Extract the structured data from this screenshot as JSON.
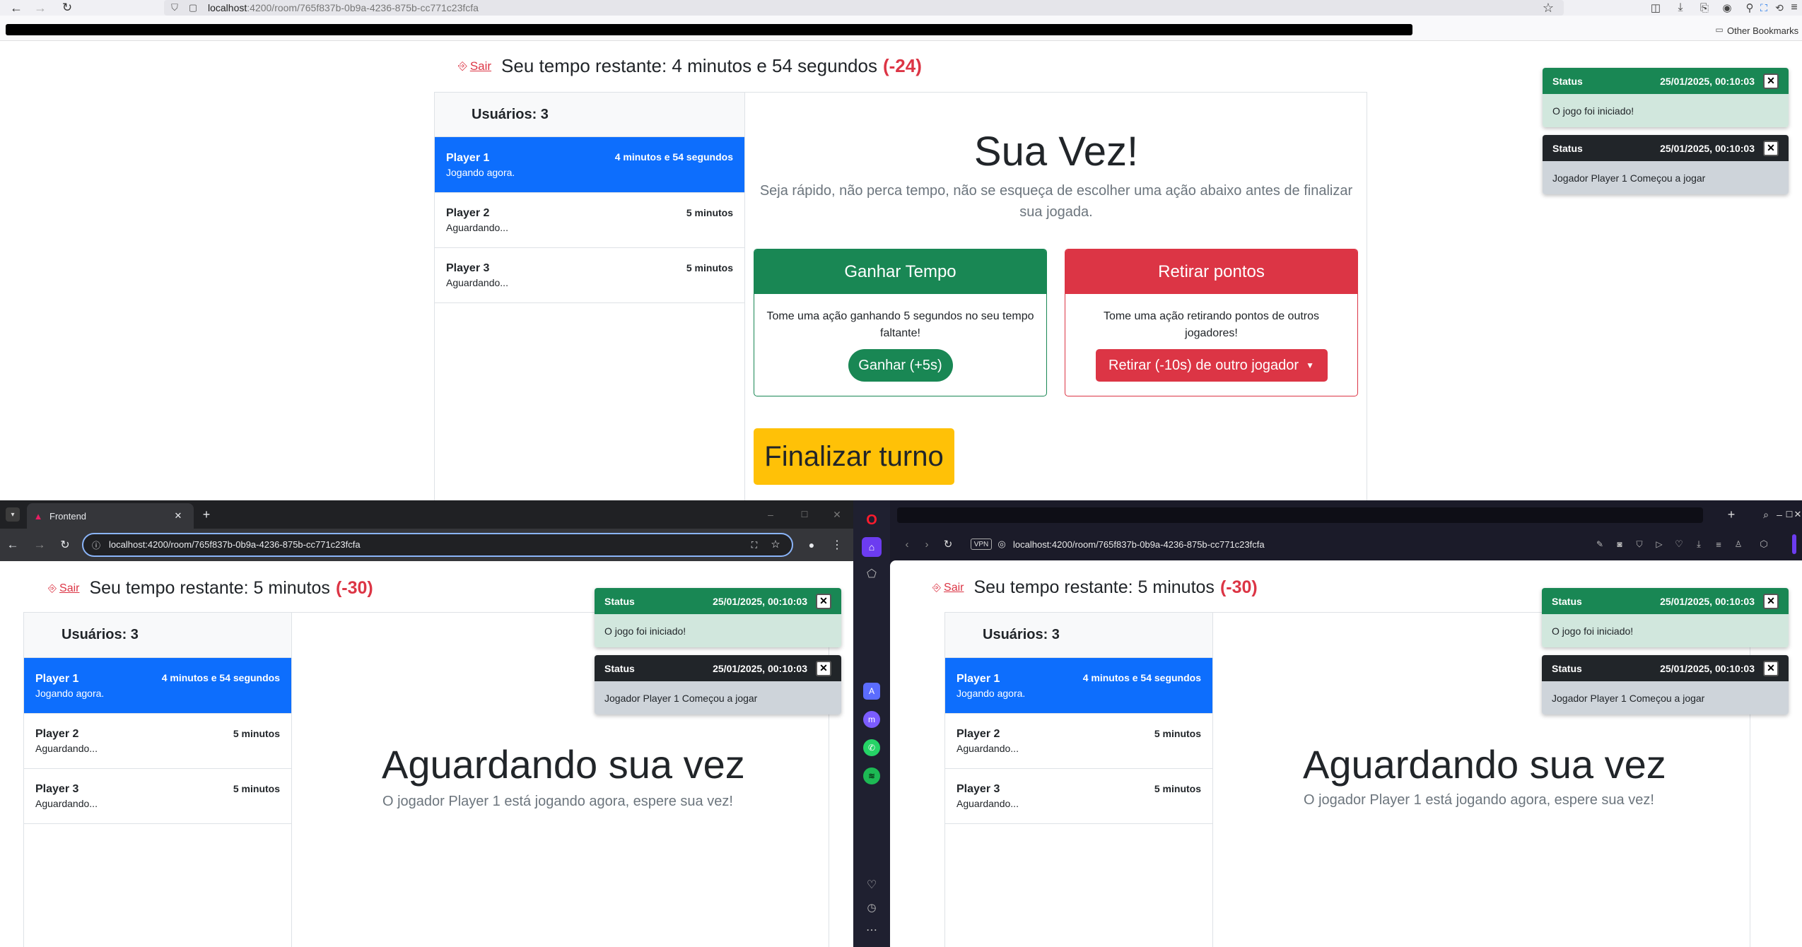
{
  "win1": {
    "url_host": "localhost",
    "url_path": ":4200/room/765f837b-0b9a-4236-875b-cc771c23fcfa",
    "bookmarks_other": "Other Bookmarks",
    "header": {
      "exit": "Sair",
      "timer_text": "Seu tempo restante: 4 minutos e 54 segundos",
      "penalty": "(-24)"
    },
    "users_header": "Usuários: 3",
    "players": [
      {
        "name": "Player 1",
        "status": "Jogando agora.",
        "time": "4 minutos e 54 segundos",
        "active": true
      },
      {
        "name": "Player 2",
        "status": "Aguardando...",
        "time": "5 minutos",
        "active": false
      },
      {
        "name": "Player 3",
        "status": "Aguardando...",
        "time": "5 minutos",
        "active": false
      }
    ],
    "main": {
      "title": "Sua Vez!",
      "subtitle": "Seja rápido, não perca tempo, não se esqueça de escolher uma ação abaixo antes de finalizar sua jogada.",
      "gain_card": {
        "header": "Ganhar Tempo",
        "text": "Tome uma ação ganhando 5 segundos no seu tempo faltante!",
        "button": "Ganhar (+5s)"
      },
      "remove_card": {
        "header": "Retirar pontos",
        "text": "Tome uma ação retirando pontos de outros jogadores!",
        "button": "Retirar (-10s) de outro jogador"
      },
      "finish_button": "Finalizar turno"
    }
  },
  "toasts": [
    {
      "title": "Status",
      "date": "25/01/2025, 00:10:03",
      "body": "O jogo foi iniciado!",
      "kind": "success"
    },
    {
      "title": "Status",
      "date": "25/01/2025, 00:10:03",
      "body": "Jogador Player 1 Começou a jogar",
      "kind": "dark"
    }
  ],
  "win2": {
    "tab_title": "Frontend",
    "url": "localhost:4200/room/765f837b-0b9a-4236-875b-cc771c23fcfa",
    "header": {
      "exit": "Sair",
      "timer_text": "Seu tempo restante: 5 minutos",
      "penalty": "(-30)"
    },
    "waiting_title": "Aguardando sua vez",
    "waiting_sub": "O jogador Player 1 está jogando agora, espere sua vez!"
  },
  "win3": {
    "vpn": "VPN",
    "url": "localhost:4200/room/765f837b-0b9a-4236-875b-cc771c23fcfa",
    "header": {
      "exit": "Sair",
      "timer_text": "Seu tempo restante: 5 minutos",
      "penalty": "(-30)"
    },
    "waiting_title": "Aguardando sua vez",
    "waiting_sub": "O jogador Player 1 está jogando agora, espere sua vez!"
  },
  "colors": {
    "primary": "#0d6efd",
    "success": "#198754",
    "danger": "#dc3545",
    "warning": "#ffc107",
    "dark": "#212529"
  }
}
